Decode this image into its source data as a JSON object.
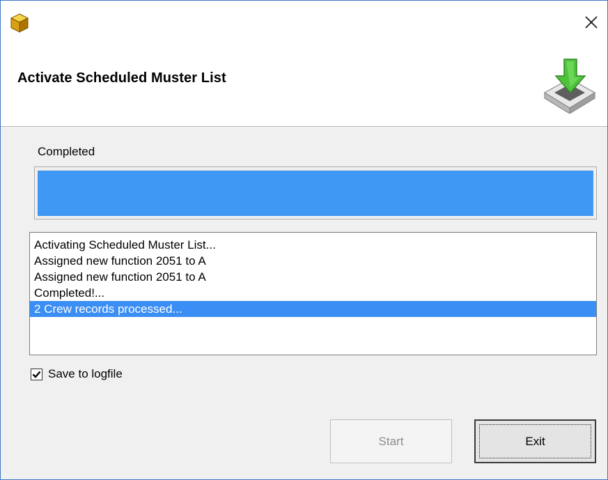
{
  "window": {
    "title": "",
    "icons": {
      "app": "gold-cube-icon",
      "close": "close-icon"
    }
  },
  "header": {
    "title": "Activate Scheduled Muster List",
    "icon": "download-to-tray-icon"
  },
  "progress": {
    "status_label": "Completed",
    "value": 1.0,
    "fill_color": "#3e98f4"
  },
  "log": {
    "items": [
      "Activating Scheduled Muster List...",
      "Assigned new function 2051 to A",
      "Assigned new function 2051 to A",
      "Completed!...",
      "2 Crew records processed..."
    ],
    "selected_index": 4,
    "selection_color": "#3b8ef4"
  },
  "options": {
    "save_logfile_label": "Save to logfile",
    "save_logfile_checked": true
  },
  "buttons": {
    "start_label": "Start",
    "start_enabled": false,
    "exit_label": "Exit"
  }
}
